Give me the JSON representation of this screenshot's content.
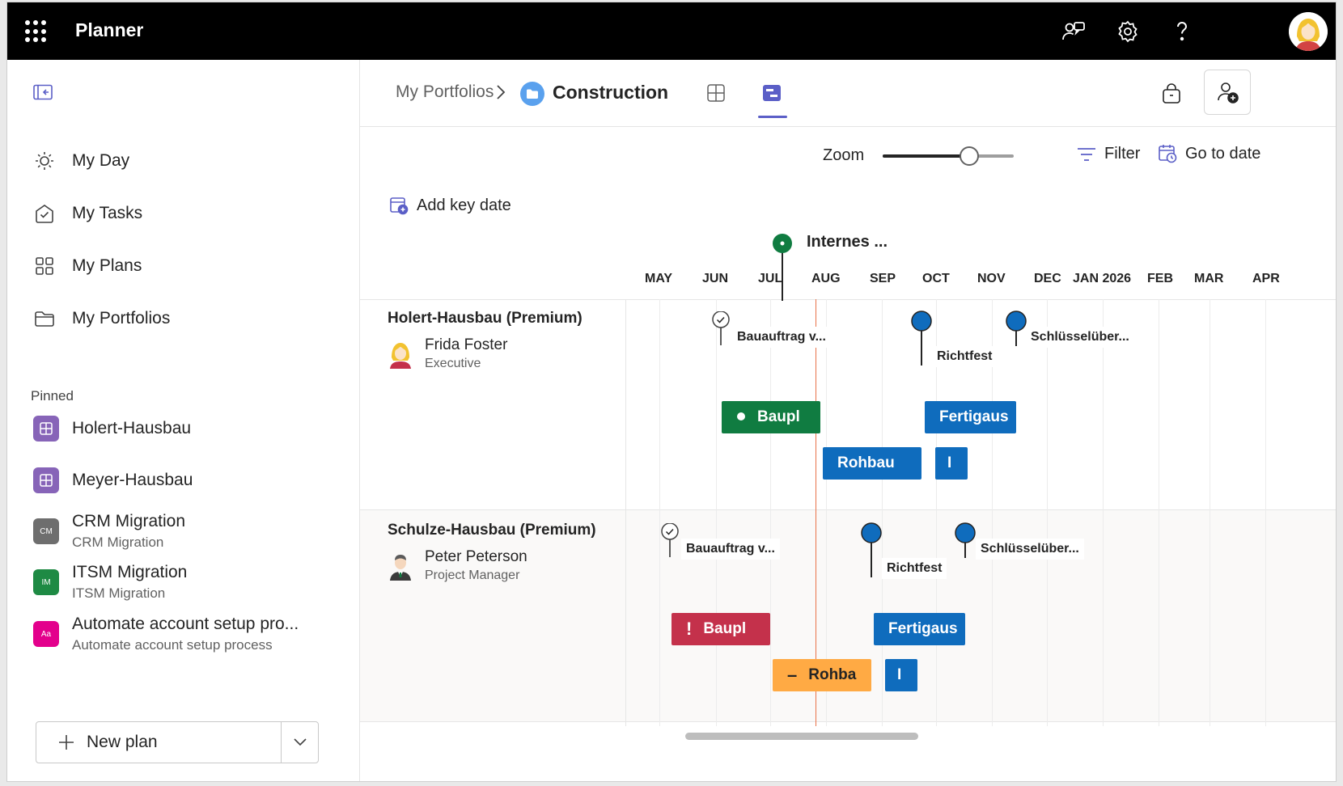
{
  "app": {
    "title": "Planner"
  },
  "sidebar": {
    "nav": [
      {
        "label": "My Day",
        "icon": "sun-icon"
      },
      {
        "label": "My Tasks",
        "icon": "tasks-icon"
      },
      {
        "label": "My Plans",
        "icon": "grid-icon"
      },
      {
        "label": "My Portfolios",
        "icon": "folder-icon"
      }
    ],
    "pinned_label": "Pinned",
    "pinned": [
      {
        "title": "Holert-Hausbau",
        "subtitle": "",
        "badge": "",
        "color": "#8764b8"
      },
      {
        "title": "Meyer-Hausbau",
        "subtitle": "",
        "badge": "",
        "color": "#8764b8"
      },
      {
        "title": "CRM Migration",
        "subtitle": "CRM Migration",
        "badge": "CM",
        "color": "#6e6e6e"
      },
      {
        "title": "ITSM Migration",
        "subtitle": "ITSM Migration",
        "badge": "IM",
        "color": "#1e8a44"
      },
      {
        "title": "Automate account setup pro...",
        "subtitle": "Automate account setup process",
        "badge": "Aa",
        "color": "#e3008c"
      }
    ],
    "new_plan_label": "New plan"
  },
  "header": {
    "breadcrumb_root": "My Portfolios",
    "breadcrumb_current": "Construction"
  },
  "toolbar": {
    "zoom_label": "Zoom",
    "zoom_level": 0.66,
    "filter_label": "Filter",
    "goto_label": "Go to date",
    "add_key_date_label": "Add key date"
  },
  "timeline": {
    "key_date_label": "Internes ...",
    "months": [
      "MAY",
      "JUN",
      "JUL",
      "AUG",
      "SEP",
      "OCT",
      "NOV",
      "DEC",
      "JAN 2026",
      "FEB",
      "MAR",
      "APR"
    ],
    "accent_colors": {
      "blue": "#0f6cbd",
      "green": "#107c41",
      "red": "#c4314b",
      "orange": "#ffaa44",
      "today": "#e9734a"
    },
    "rows": [
      {
        "plan": "Holert-Hausbau (Premium)",
        "person_name": "Frida Foster",
        "person_role": "Executive",
        "milestones": [
          "Bauauftrag v...",
          "Richtfest",
          "Schlüsselüber..."
        ],
        "bars": [
          "Baupl",
          "Fertigaus",
          "Rohbau",
          "I"
        ]
      },
      {
        "plan": "Schulze-Hausbau (Premium)",
        "person_name": "Peter Peterson",
        "person_role": "Project Manager",
        "milestones": [
          "Bauauftrag v...",
          "Richtfest",
          "Schlüsselüber..."
        ],
        "bars": [
          "Baupl",
          "Fertigaus",
          "Rohba",
          "I"
        ]
      }
    ]
  }
}
